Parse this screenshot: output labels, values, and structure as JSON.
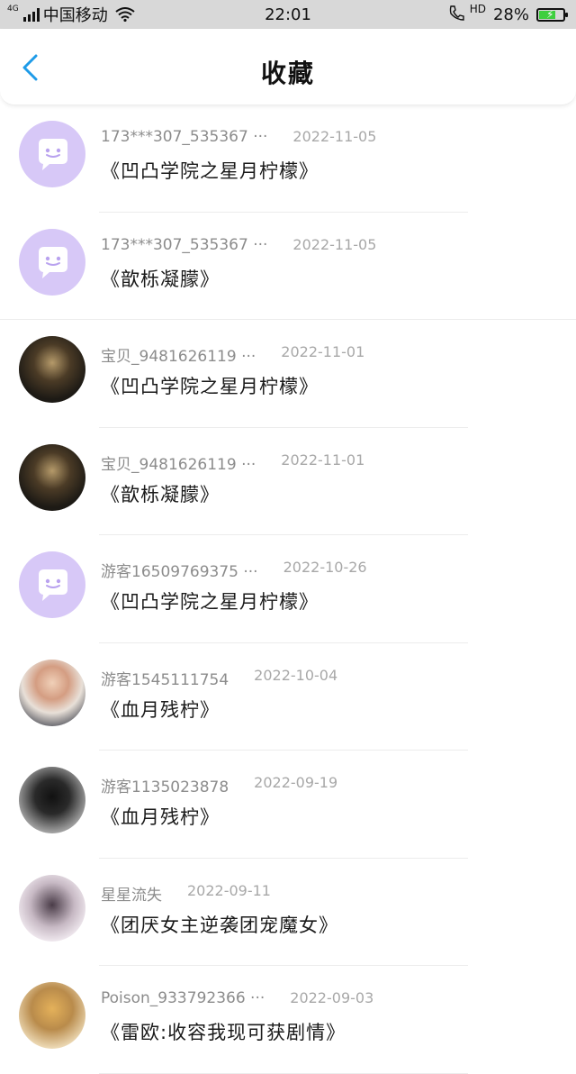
{
  "status_bar": {
    "network_tag": "4G",
    "carrier": "中国移动",
    "time": "22:01",
    "call_tag": "HD",
    "battery_percent": "28%",
    "battery_level": 0.28
  },
  "header": {
    "title": "收藏"
  },
  "items": [
    {
      "user": "173***307_535367 ···",
      "date": "2022-11-05",
      "book": "《凹凸学院之星月柠檬》",
      "avatar": "default"
    },
    {
      "user": "173***307_535367 ···",
      "date": "2022-11-05",
      "book": "《歆栎凝朦》",
      "avatar": "default"
    },
    {
      "user": "宝贝_9481626119 ···",
      "date": "2022-11-01",
      "book": "《凹凸学院之星月柠檬》",
      "avatar": "photo1"
    },
    {
      "user": "宝贝_9481626119 ···",
      "date": "2022-11-01",
      "book": "《歆栎凝朦》",
      "avatar": "photo1"
    },
    {
      "user": "游客16509769375 ···",
      "date": "2022-10-26",
      "book": "《凹凸学院之星月柠檬》",
      "avatar": "default"
    },
    {
      "user": "游客1545111754",
      "date": "2022-10-04",
      "book": "《血月残柠》",
      "avatar": "photo2"
    },
    {
      "user": "游客1135023878",
      "date": "2022-09-19",
      "book": "《血月残柠》",
      "avatar": "photo3"
    },
    {
      "user": "星星流失",
      "date": "2022-09-11",
      "book": "《团厌女主逆袭团宠魔女》",
      "avatar": "photo4"
    },
    {
      "user": "Poison_933792366 ···",
      "date": "2022-09-03",
      "book": "《雷欧:收容我现可获剧情》",
      "avatar": "photo5"
    }
  ],
  "colors": {
    "accent": "#1e9be8",
    "default_avatar": "#d7c8f7"
  }
}
